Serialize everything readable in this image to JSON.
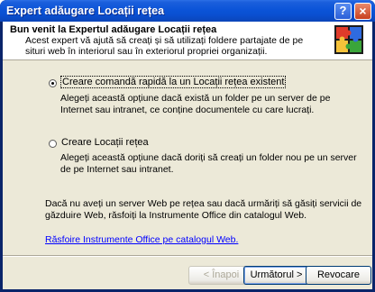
{
  "window": {
    "title": "Expert adăugare Locații rețea",
    "help_glyph": "?",
    "close_glyph": "×"
  },
  "header": {
    "title": "Bun venit la Expertul adăugare Locații rețea",
    "description": "Acest expert vă ajută să creați și să utilizați foldere partajate de pe situri web în interiorul sau în exteriorul propriei organizații."
  },
  "options": [
    {
      "label": "Creare comandă rapidă la un Locații rețea existent",
      "selected": true,
      "description": "Alegeți această opțiune dacă există un folder pe un server de pe Internet sau intranet, ce conține documentele cu care lucrați."
    },
    {
      "label": "Creare Locații rețea",
      "selected": false,
      "description": "Alegeți această opțiune dacă doriți să creați un folder nou pe un server de pe Internet sau intranet."
    }
  ],
  "info_text": "Dacă nu aveți un server Web pe rețea sau dacă urmăriți să găsiți servicii de găzduire Web, răsfoiți la Instrumente Office din catalogul Web.",
  "link_text": "Răsfoire Instrumente Office pe catalogul Web.",
  "buttons": {
    "back": "< Înapoi",
    "next": "Următorul >",
    "cancel": "Revocare"
  },
  "icons": {
    "logo": "office-puzzle-icon"
  },
  "colors": {
    "titlebar": "#0b54d8",
    "dialog": "#ece9d8",
    "link": "#0000ff"
  }
}
